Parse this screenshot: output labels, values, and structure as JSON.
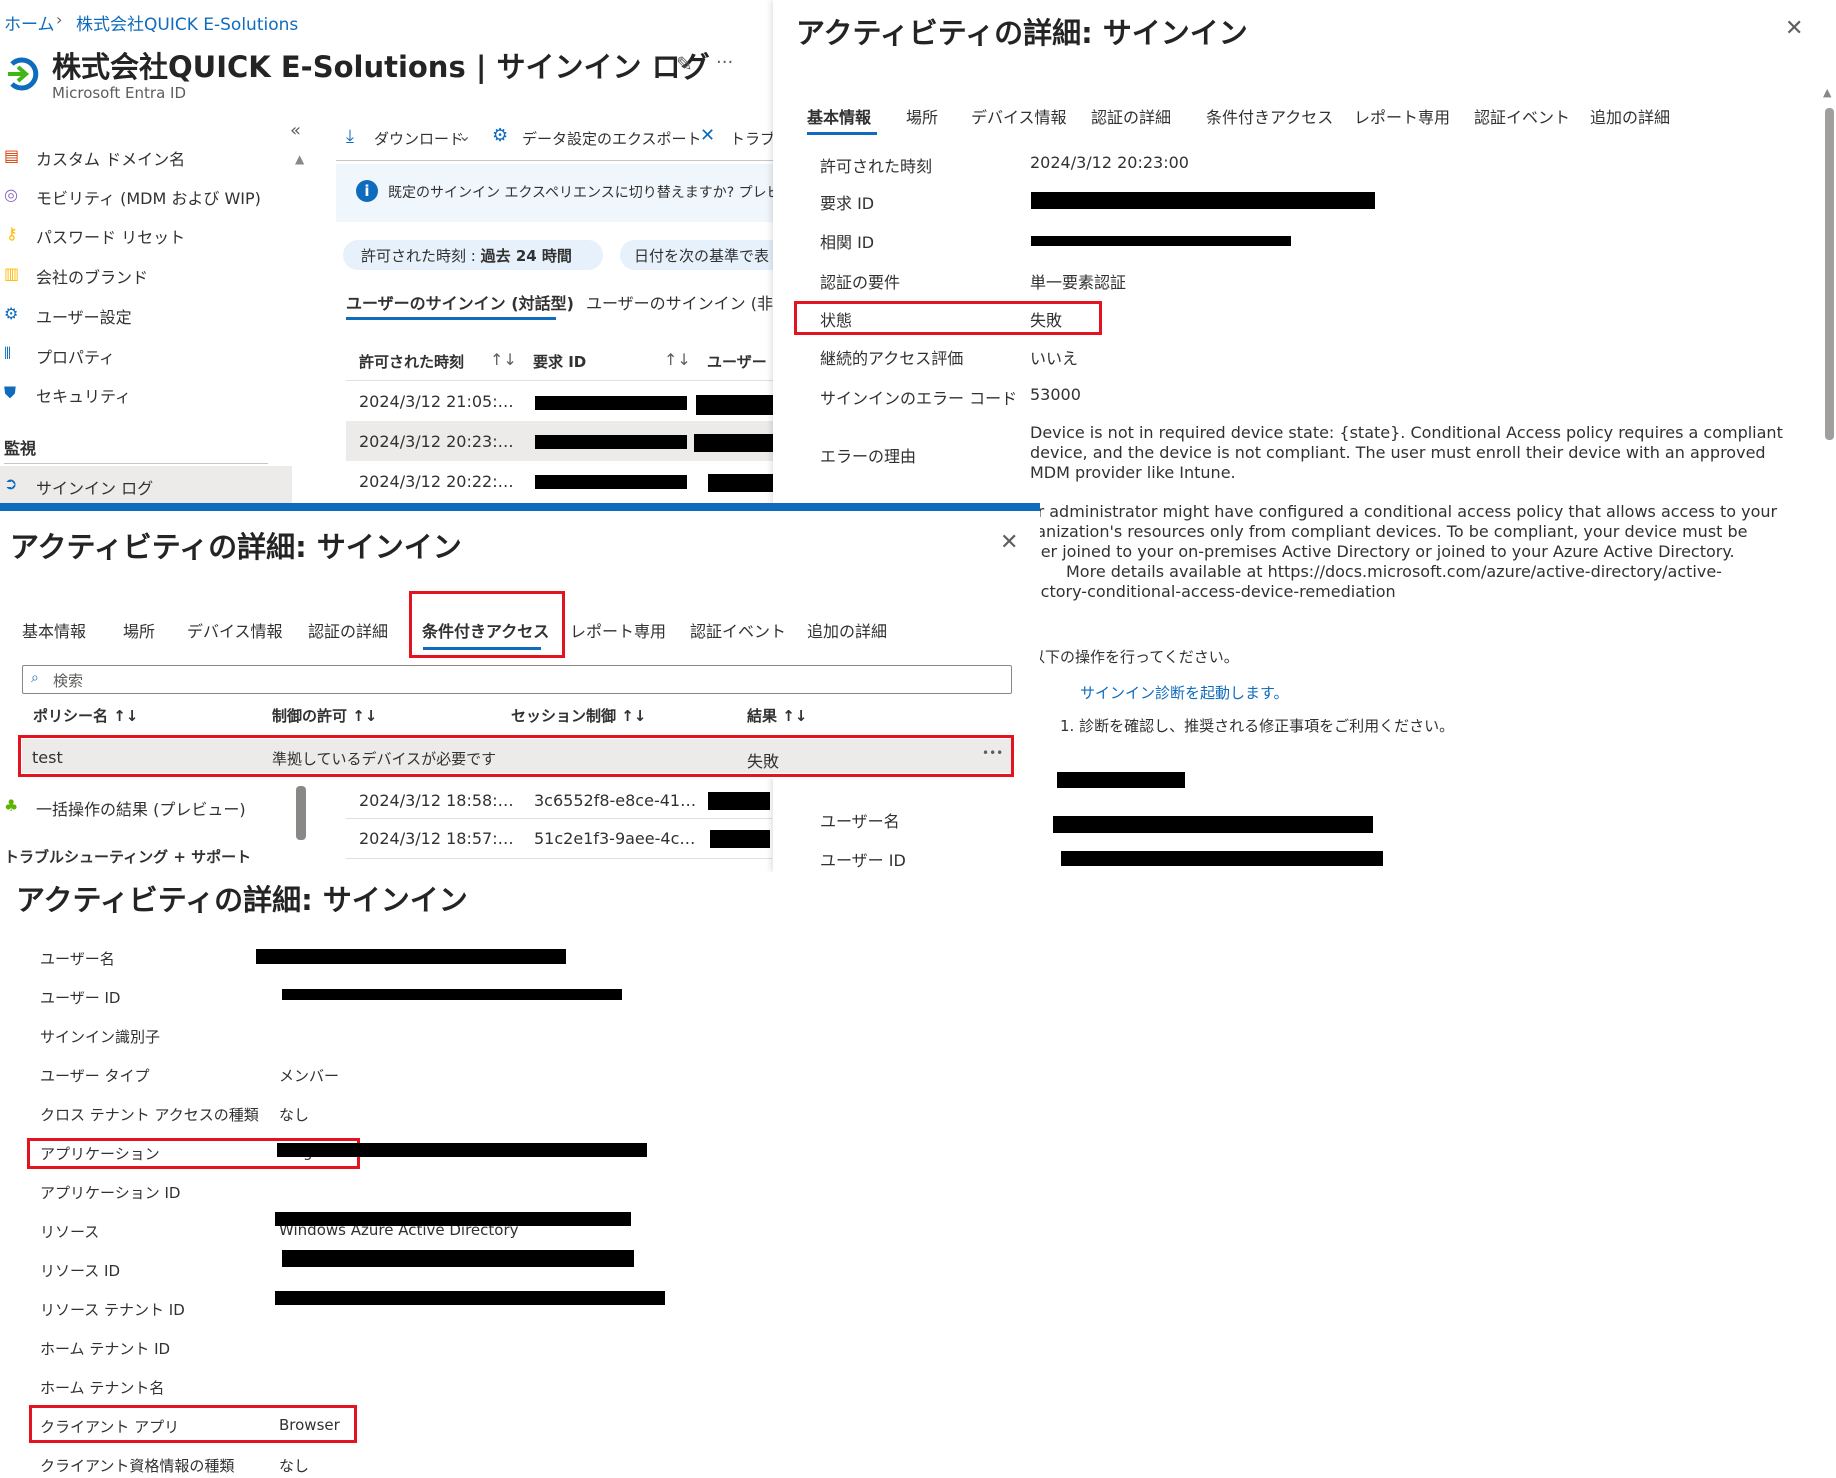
{
  "portal": {
    "breadcrumb": [
      "ホーム",
      "株式会社QUICK E-Solutions"
    ],
    "title": "株式会社QUICK E-Solutions | サインイン ログ",
    "subtitle": "Microsoft Entra ID",
    "pin_icon": "pin-icon",
    "more": "···",
    "collapse": "«",
    "sidebar": {
      "items": [
        "カスタム ドメイン名",
        "モビリティ (MDM および WIP)",
        "パスワード リセット",
        "会社のブランド",
        "ユーザー設定",
        "プロパティ",
        "セキュリティ"
      ],
      "section": "監視",
      "active": "サインイン ログ",
      "bulk": "一括操作の結果 (プレビュー)",
      "trouble": "トラブルシューティング + サポート"
    },
    "toolbar": {
      "download": "ダウンロード",
      "export": "データ設定のエクスポート",
      "troubleshoot": "トラブ"
    },
    "banner": "既定のサインイン エクスペリエンスに切り替えますか? プレビューを終",
    "filters": {
      "time_label": "許可された時刻 : ",
      "time_value": "過去 24 時間",
      "date": "日付を次の基準で表"
    },
    "tabs": [
      "ユーザーのサインイン (対話型)",
      "ユーザーのサインイン (非対"
    ],
    "table": {
      "headers": [
        "許可された時刻",
        "要求 ID",
        "ユーザー"
      ],
      "rows": [
        {
          "time": "2024/3/12 21:05:…"
        },
        {
          "time": "2024/3/12 20:23:…"
        },
        {
          "time": "2024/3/12 20:22:…"
        },
        {
          "time": "2024/3/12 18:58:…",
          "id": "3c6552f8-e8ce-41…"
        },
        {
          "time": "2024/3/12 18:57:…",
          "id": "51c2e1f3-9aee-4c…"
        }
      ]
    }
  },
  "detail_basic": {
    "title": "アクティビティの詳細: サインイン",
    "close": "✕",
    "tabs": [
      "基本情報",
      "場所",
      "デバイス情報",
      "認証の詳細",
      "条件付きアクセス",
      "レポート専用",
      "認証イベント",
      "追加の詳細"
    ],
    "active_tab": "基本情報",
    "rows": [
      {
        "label": "許可された時刻",
        "value": "2024/3/12 20:23:00"
      },
      {
        "label": "要求 ID",
        "value": ""
      },
      {
        "label": "相関 ID",
        "value": ""
      },
      {
        "label": "認証の要件",
        "value": "単一要素認証"
      },
      {
        "label": "状態",
        "value": "失敗"
      },
      {
        "label": "継続的アクセス評価",
        "value": "いいえ"
      },
      {
        "label": "サインインのエラー コード",
        "value": "53000"
      }
    ],
    "error_label": "エラーの理由",
    "error_text": "Device is not in required device state: {state}. Conditional Access policy requires a compliant device, and the device is not compliant. The user must enroll their device with an approved MDM provider like Intune.",
    "error_text2": "Your administrator might have configured a conditional access policy that allows access to your organization's resources only from compliant devices. To be compliant, your device must be either joined to your on-premises Active Directory or joined to your Azure Active Directory.",
    "error_text3": "More details available at https://docs.microsoft.com/azure/active-directory/active-directory-conditional-access-device-remediation",
    "action": "以下の操作を行ってください。",
    "diag_link": "サインイン診断を起動します。",
    "step": "1. 診断を確認し、推奨される修正事項をご利用ください。",
    "lower_labels": [
      "ユーザー名",
      "ユーザー ID"
    ]
  },
  "detail_ca": {
    "title": "アクティビティの詳細: サインイン",
    "close": "✕",
    "tabs": [
      "基本情報",
      "場所",
      "デバイス情報",
      "認証の詳細",
      "条件付きアクセス",
      "レポート専用",
      "認証イベント",
      "追加の詳細"
    ],
    "active_tab": "条件付きアクセス",
    "search_placeholder": "検索",
    "headers": [
      "ポリシー名 ↑↓",
      "制御の許可 ↑↓",
      "セッション制御 ↑↓",
      "結果 ↑↓"
    ],
    "row": {
      "policy": "test",
      "grant": "準拠しているデバイスが必要です",
      "session": "",
      "result": "失敗",
      "more": "•••"
    }
  },
  "detail_user": {
    "title": "アクティビティの詳細: サインイン",
    "rows": [
      {
        "label": "ユーザー名",
        "value": ""
      },
      {
        "label": "ユーザー ID",
        "value": ""
      },
      {
        "label": "サインイン識別子",
        "value": ""
      },
      {
        "label": "ユーザー タイプ",
        "value": "メンバー"
      },
      {
        "label": "クロス テナント アクセスの種類",
        "value": "なし"
      },
      {
        "label": "アプリケーション",
        "value": "Bing"
      },
      {
        "label": "アプリケーション ID",
        "value": ""
      },
      {
        "label": "リソース",
        "value": "Windows Azure Active Directory"
      },
      {
        "label": "リソース ID",
        "value": ""
      },
      {
        "label": "リソース テナント ID",
        "value": ""
      },
      {
        "label": "ホーム テナント ID",
        "value": ""
      },
      {
        "label": "ホーム テナント名",
        "value": ""
      },
      {
        "label": "クライアント アプリ",
        "value": "Browser"
      },
      {
        "label": "クライアント資格情報の種類",
        "value": "なし"
      }
    ]
  },
  "colors": {
    "accent": "#0f6cbd",
    "highlight": "#e3141f"
  }
}
